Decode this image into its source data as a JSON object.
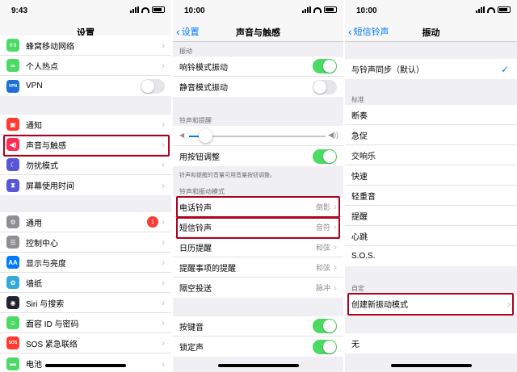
{
  "panel1": {
    "time": "9:43",
    "title": "设置",
    "group_a": [
      {
        "label": "蜂窝移动网络",
        "icon": "cellular-icon",
        "color": "#4cd964",
        "glyph": "((·))"
      },
      {
        "label": "个人热点",
        "icon": "hotspot-icon",
        "color": "#4cd964",
        "glyph": "∞"
      },
      {
        "label": "VPN",
        "icon": "vpn-icon",
        "color": "#1e6fd9",
        "glyph": "VPN"
      }
    ],
    "group_b": [
      {
        "label": "通知",
        "icon": "notification-icon",
        "color": "#ff3b30",
        "glyph": "▣"
      },
      {
        "label": "声音与触感",
        "icon": "sound-icon",
        "color": "#ff2d55",
        "glyph": "◀)"
      },
      {
        "label": "勿扰模式",
        "icon": "moon-icon",
        "color": "#5856d6",
        "glyph": "☾"
      },
      {
        "label": "屏幕使用时间",
        "icon": "hourglass-icon",
        "color": "#5856d6",
        "glyph": "⧗"
      }
    ],
    "group_c": [
      {
        "label": "通用",
        "icon": "gear-icon",
        "color": "#8e8e93",
        "glyph": "⚙",
        "badge": "1"
      },
      {
        "label": "控制中心",
        "icon": "control-center-icon",
        "color": "#8e8e93",
        "glyph": "☰"
      },
      {
        "label": "显示与亮度",
        "icon": "display-icon",
        "color": "#007aff",
        "glyph": "AA"
      },
      {
        "label": "墙纸",
        "icon": "wallpaper-icon",
        "color": "#34aadc",
        "glyph": "✿"
      },
      {
        "label": "Siri 与搜索",
        "icon": "siri-icon",
        "color": "#222233",
        "glyph": "◉"
      },
      {
        "label": "面容 ID 与密码",
        "icon": "faceid-icon",
        "color": "#4cd964",
        "glyph": "☺"
      },
      {
        "label": "SOS 紧急联络",
        "icon": "sos-icon",
        "color": "#ff3b30",
        "glyph": "SOS"
      },
      {
        "label": "电池",
        "icon": "battery-icon",
        "color": "#4cd964",
        "glyph": "▬"
      }
    ]
  },
  "panel2": {
    "time": "10:00",
    "back": "设置",
    "title": "声音与触感",
    "sec_vibrate": "振动",
    "vibrate_rows": [
      {
        "label": "响铃模式振动",
        "on": true
      },
      {
        "label": "静音模式振动",
        "on": false
      }
    ],
    "sec_ringer": "铃声和提醒",
    "ringer_slider": 0.12,
    "change_with_buttons": "用按钮调整",
    "ringer_footer": "铃声和提醒的音量可用音量按钮调整。",
    "sec_patterns": "铃声和振动模式",
    "pattern_rows": [
      {
        "label": "电话铃声",
        "value": "倒影"
      },
      {
        "label": "短信铃声",
        "value": "音符"
      },
      {
        "label": "日历提醒",
        "value": "和弦"
      },
      {
        "label": "提醒事项的提醒",
        "value": "和弦"
      },
      {
        "label": "隔空投送",
        "value": "脉冲"
      }
    ],
    "bottom_rows": [
      {
        "label": "按键音",
        "on": true
      },
      {
        "label": "锁定声",
        "on": true
      }
    ]
  },
  "panel3": {
    "time": "10:00",
    "back": "短信铃声",
    "title": "振动",
    "sync": "与铃声同步（默认）",
    "sec_standard": "标准",
    "standard_rows": [
      "断奏",
      "急促",
      "交响乐",
      "快速",
      "轻重音",
      "提醒",
      "心跳",
      "S.O.S."
    ],
    "sec_custom": "自定",
    "create_new": "创建新振动模式",
    "none": "无"
  },
  "colors": {
    "highlight": "#b0001e",
    "accent": "#007aff",
    "toggle_on": "#4cd964"
  }
}
